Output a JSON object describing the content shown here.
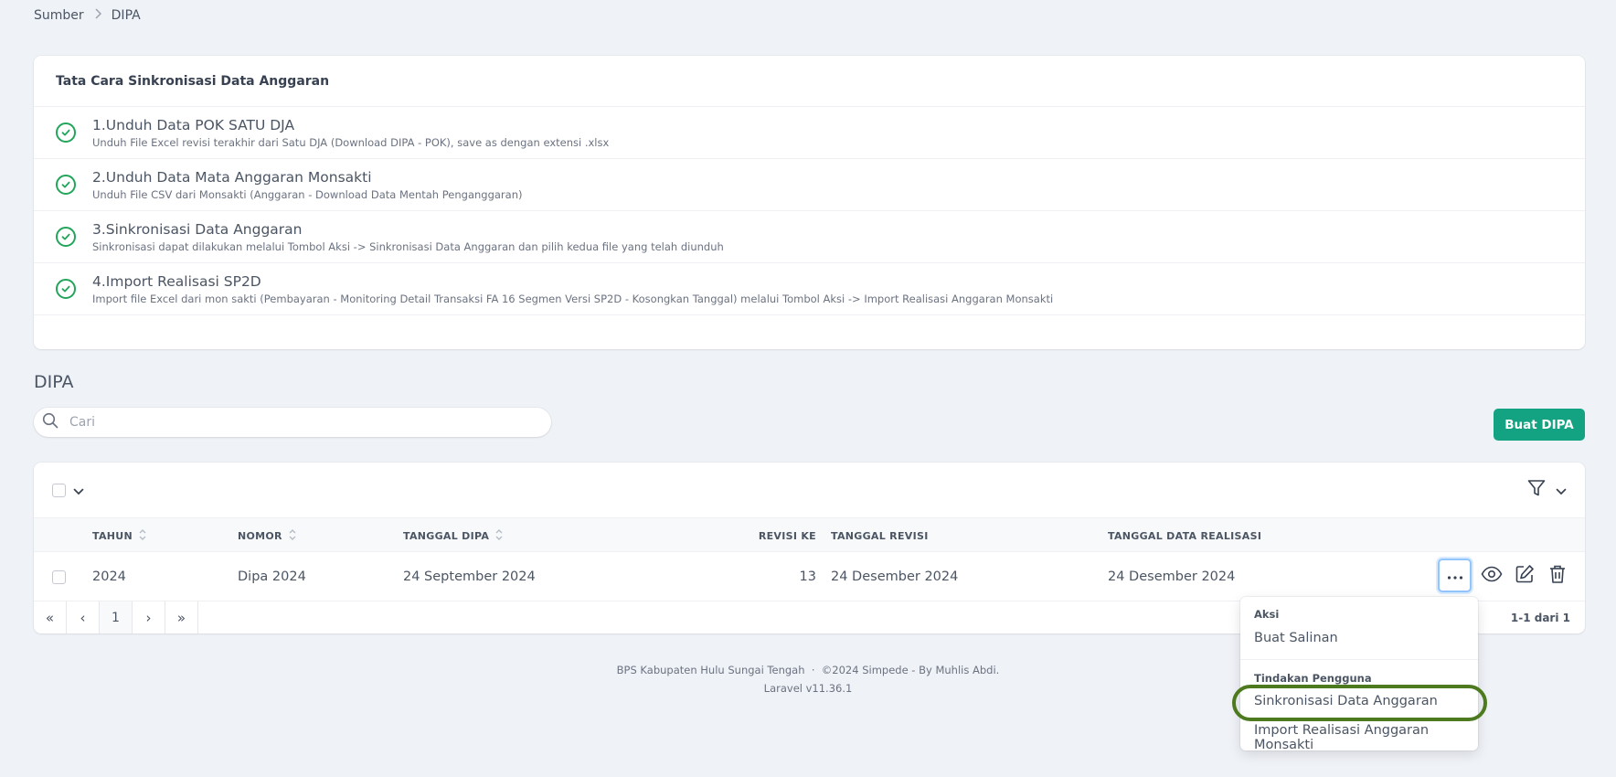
{
  "breadcrumb": {
    "root": "Sumber",
    "current": "DIPA"
  },
  "steps_card": {
    "title": "Tata Cara Sinkronisasi Data Anggaran",
    "steps": [
      {
        "title": "1.Unduh Data POK SATU DJA",
        "desc": "Unduh File Excel revisi terakhir dari Satu DJA (Download DIPA - POK), save as dengan extensi .xlsx"
      },
      {
        "title": "2.Unduh Data Mata Anggaran Monsakti",
        "desc": "Unduh File CSV dari Monsakti (Anggaran - Download Data Mentah Penganggaran)"
      },
      {
        "title": "3.Sinkronisasi Data Anggaran",
        "desc": "Sinkronisasi dapat dilakukan melalui Tombol Aksi -> Sinkronisasi Data Anggaran dan pilih kedua file yang telah diunduh"
      },
      {
        "title": "4.Import Realisasi SP2D",
        "desc": "Import file Excel dari mon sakti (Pembayaran - Monitoring Detail Transaksi FA 16 Segmen Versi SP2D - Kosongkan Tanggal) melalui Tombol Aksi -> Import Realisasi Anggaran Monsakti"
      }
    ]
  },
  "section_title": "DIPA",
  "search": {
    "placeholder": "Cari",
    "value": ""
  },
  "create_button": "Buat DIPA",
  "table": {
    "columns": {
      "tahun": "TAHUN",
      "nomor": "NOMOR",
      "tanggal_dipa": "TANGGAL DIPA",
      "revisi_ke": "REVISI KE",
      "tanggal_revisi": "TANGGAL REVISI",
      "tanggal_data_realisasi": "TANGGAL DATA REALISASI"
    },
    "rows": [
      {
        "tahun": "2024",
        "nomor": "Dipa 2024",
        "tanggal_dipa": "24 September 2024",
        "revisi_ke": "13",
        "tanggal_revisi": "24 Desember 2024",
        "tanggal_data_realisasi": "24 Desember 2024"
      }
    ],
    "pagination": {
      "first": "«",
      "prev": "‹",
      "page": "1",
      "next": "›",
      "last": "»",
      "count": "1-1 dari 1"
    }
  },
  "footer": {
    "line1": "BPS Kabupaten Hulu Sungai Tengah  ·  ©2024 Simpede - By Muhlis Abdi.",
    "line2": "Laravel v11.36.1"
  },
  "dropdown": {
    "group1_label": "Aksi",
    "group1_items": [
      "Buat Salinan"
    ],
    "group2_label": "Tindakan Pengguna",
    "group2_items": [
      "Sinkronisasi Data Anggaran",
      "Import Realisasi Anggaran Monsakti"
    ]
  },
  "colors": {
    "accent": "#13a383",
    "check": "#22a55b",
    "highlight_ring": "#4e7a1f",
    "focus": "#93c5fd"
  }
}
